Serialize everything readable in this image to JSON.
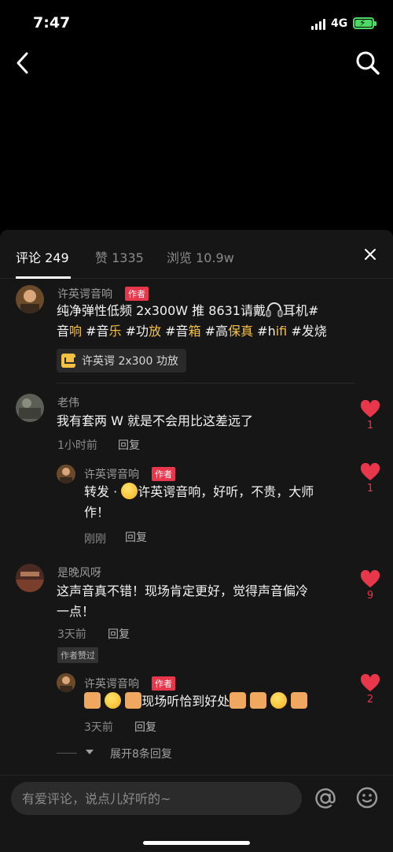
{
  "status_bar": {
    "time": "7:47",
    "network": "4G"
  },
  "tabs": [
    {
      "label": "评论 249",
      "active": true
    },
    {
      "label": "赞 1335",
      "active": false
    },
    {
      "label": "浏览 10.9w",
      "active": false
    }
  ],
  "author_badge": "作者",
  "comments": [
    {
      "user": "许英谔音响",
      "is_author": true,
      "text_line1": "纯净弹性低频 2x300W 推 8631请戴",
      "text_line1_tail": "耳机#",
      "text_line2": [
        {
          "t": "音",
          "hl": false
        },
        {
          "t": "响",
          "hl": true
        },
        {
          "t": " #音",
          "hl": false
        },
        {
          "t": "乐",
          "hl": true
        },
        {
          "t": " #功",
          "hl": false
        },
        {
          "t": "放",
          "hl": true
        },
        {
          "t": " #音",
          "hl": false
        },
        {
          "t": "箱",
          "hl": true
        },
        {
          "t": " #高",
          "hl": false
        },
        {
          "t": "保真",
          "hl": true
        },
        {
          "t": " #h",
          "hl": false
        },
        {
          "t": "ifi",
          "hl": true
        },
        {
          "t": " #发烧",
          "hl": false
        }
      ],
      "product": "许英谔 2x300 功放"
    },
    {
      "user": "老伟",
      "text": "我有套两 W 就是不会用比这差远了",
      "time": "1小时前",
      "reply": "回复",
      "likes": "1",
      "sub": {
        "user": "许英谔音响",
        "is_author": true,
        "text_line1": "转发 · ",
        "text_line1_tail": "许英谔音响，好听，不贵，大师",
        "text_line2": "作！",
        "time": "刚刚",
        "reply": "回复",
        "likes": "1"
      }
    },
    {
      "user": "是晚风呀",
      "text_line1": "这声音真不错！现场肯定更好，觉得声音偏冷",
      "text_line2": "一点！",
      "time": "3天前",
      "reply": "回复",
      "likes": "9",
      "liked_by_author": "作者赞过",
      "sub": {
        "user": "许英谔音响",
        "is_author": true,
        "text": "现场听恰到好处",
        "time": "3天前",
        "reply": "回复",
        "likes": "2"
      },
      "expand": "展开8条回复"
    }
  ],
  "input": {
    "placeholder": "有爱评论，说点儿好听的~"
  },
  "colors": {
    "accent_red": "#e8364a",
    "hashtag": "#f5c142",
    "panel": "#161616"
  }
}
